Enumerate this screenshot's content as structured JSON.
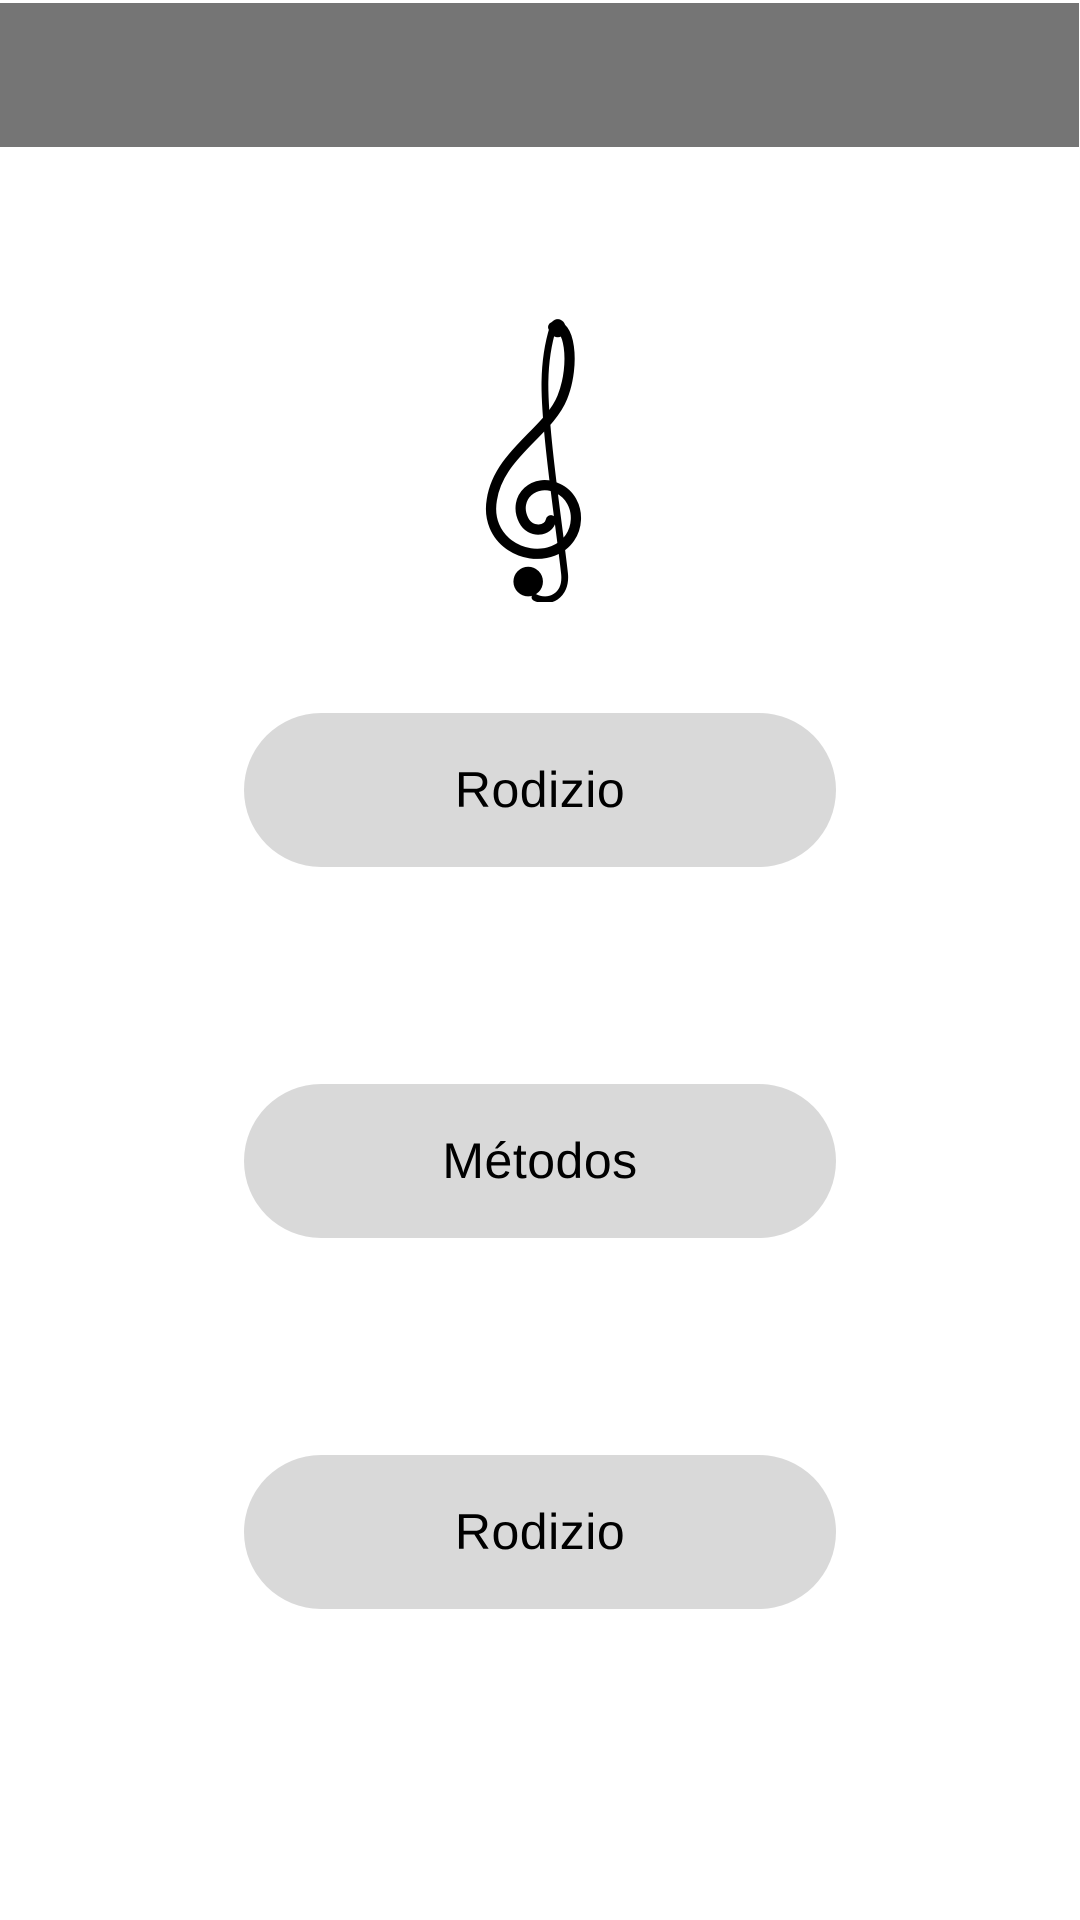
{
  "app": {
    "logo_icon": "treble-clef-icon"
  },
  "colors": {
    "top_bar": "#757575",
    "button_background": "#d9d9d9",
    "button_text": "#000000",
    "background": "#ffffff"
  },
  "menu": {
    "buttons": [
      {
        "label": "Rodizio"
      },
      {
        "label": "Métodos"
      },
      {
        "label": "Rodizio"
      }
    ]
  }
}
